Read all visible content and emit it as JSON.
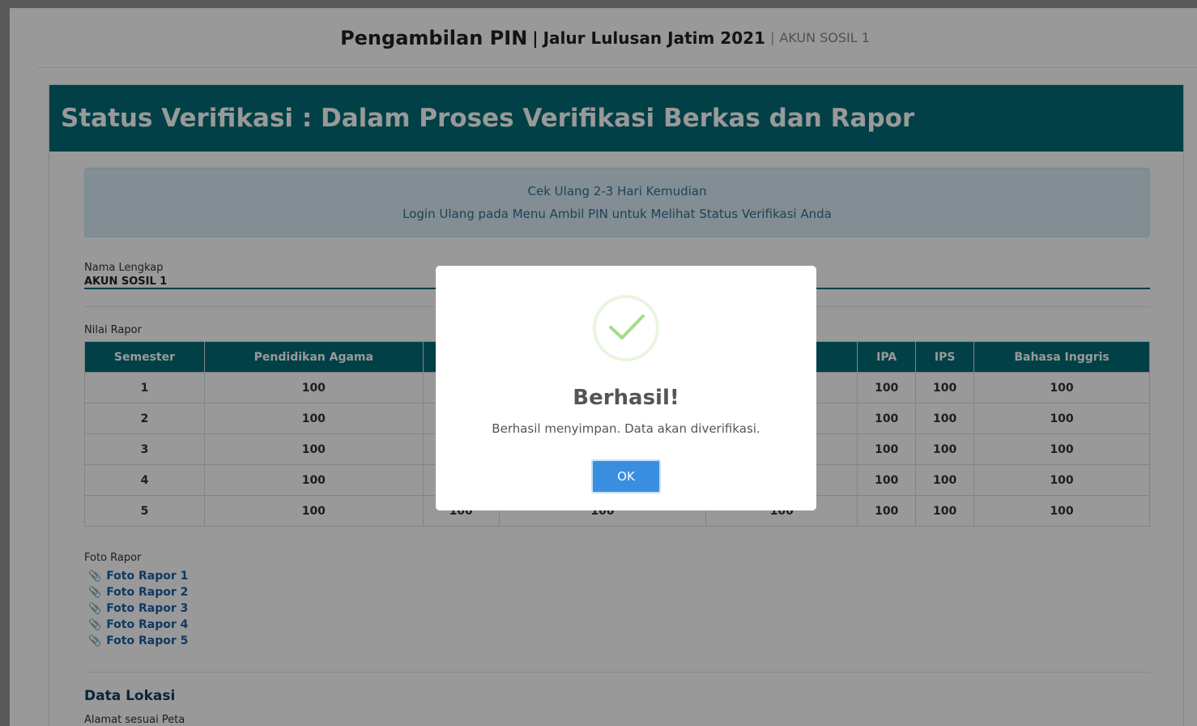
{
  "header": {
    "title": "Pengambilan PIN",
    "separator": "|",
    "subtitle": "Jalur Lulusan Jatim 2021",
    "account": "AKUN SOSIL 1"
  },
  "status": {
    "heading": "Status Verifikasi : Dalam Proses Verifikasi Berkas dan Rapor",
    "info_line1": "Cek Ulang 2-3 Hari Kemudian",
    "info_line2": "Login Ulang pada Menu Ambil PIN untuk Melihat Status Verifikasi Anda"
  },
  "profile": {
    "name_label": "Nama Lengkap",
    "name_value": "AKUN SOSIL 1"
  },
  "rapor": {
    "label": "Nilai Rapor",
    "columns": [
      "Semester",
      "Pendidikan Agama",
      "",
      "",
      "",
      "IPA",
      "IPS",
      "Bahasa Inggris"
    ],
    "rows": [
      [
        "1",
        "100",
        "",
        "",
        "",
        "100",
        "100",
        "100"
      ],
      [
        "2",
        "100",
        "",
        "",
        "",
        "100",
        "100",
        "100"
      ],
      [
        "3",
        "100",
        "",
        "",
        "",
        "100",
        "100",
        "100"
      ],
      [
        "4",
        "100",
        "",
        "",
        "",
        "100",
        "100",
        "100"
      ],
      [
        "5",
        "100",
        "100",
        "100",
        "100",
        "100",
        "100",
        "100"
      ]
    ]
  },
  "foto": {
    "label": "Foto Rapor",
    "links": [
      "Foto Rapor 1",
      "Foto Rapor 2",
      "Foto Rapor 3",
      "Foto Rapor 4",
      "Foto Rapor 5"
    ]
  },
  "lokasi": {
    "title": "Data Lokasi",
    "address_label": "Alamat sesuai Peta"
  },
  "modal": {
    "title": "Berhasil!",
    "message": "Berhasil menyimpan. Data akan diverifikasi.",
    "ok_label": "OK",
    "icon": "success-check-icon"
  },
  "colors": {
    "teal": "#006c75",
    "info_bg": "#d9edf7",
    "link": "#1a5fa8",
    "ok_button": "#3a8ee0",
    "check": "#a5dc86"
  }
}
